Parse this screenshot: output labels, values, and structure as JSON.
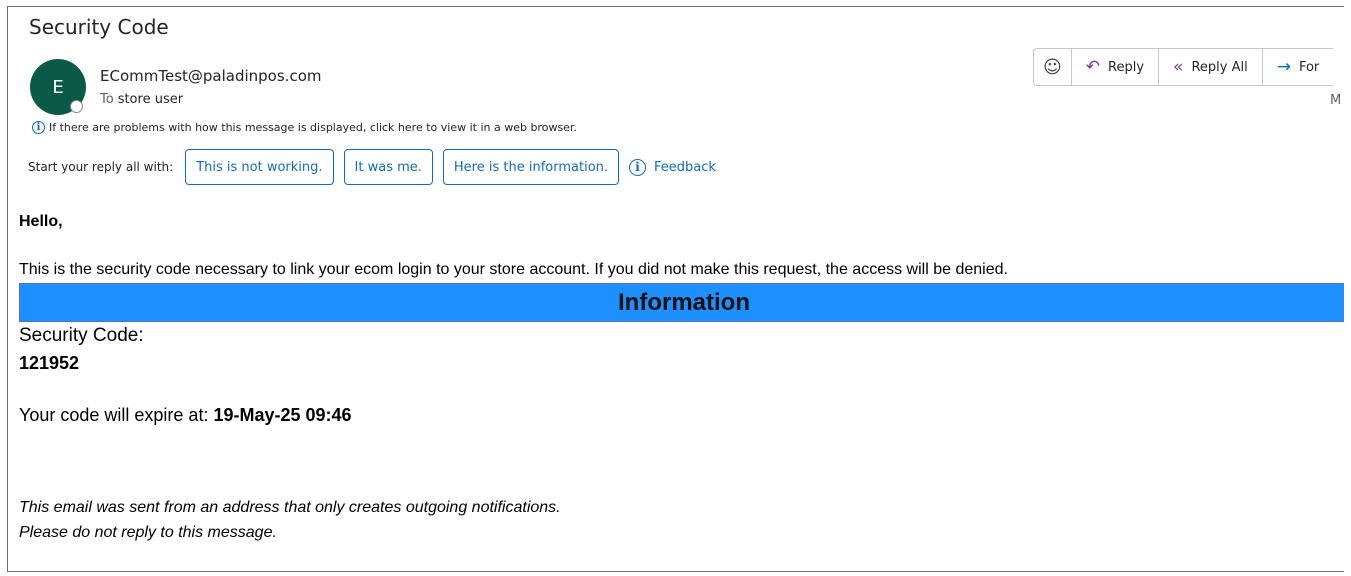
{
  "message": {
    "subject": "Security Code",
    "sender_initial": "E",
    "sender_email": "ECommTest@paladinpos.com",
    "to_label": "To",
    "to_value": "store user",
    "info_notice": "If there are problems with how this message is displayed, click here to view it in a web browser.",
    "date_stub": "M"
  },
  "suggested_replies": {
    "label": "Start your reply all with:",
    "options": [
      "This is not working.",
      "It was me.",
      "Here is the information."
    ],
    "feedback_label": "Feedback"
  },
  "actions": {
    "reply_label": "Reply",
    "reply_all_label": "Reply All",
    "forward_label": "For"
  },
  "body": {
    "greeting": "Hello,",
    "intro": "This is the security code necessary to link your ecom login to your store account. If you did not make this request, the access will be denied.",
    "section_header": "Information",
    "code_label": "Security Code:",
    "code_value": "121952",
    "expire_label": "Your code will expire at: ",
    "expire_value": "19-May-25 09:46",
    "footer_line1": "This email was sent from an address that only creates outgoing notifications.",
    "footer_line2": "Please do not reply to this message."
  },
  "colors": {
    "avatar_bg": "#0b5a47",
    "accent_link": "#0f6cbd",
    "reply_icon": "#8b2f9a",
    "info_bar": "#1e8fff"
  }
}
